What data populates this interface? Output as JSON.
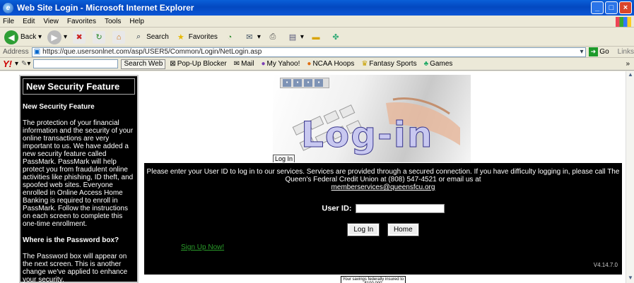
{
  "window": {
    "title": "Web Site Login - Microsoft Internet Explorer"
  },
  "menu": [
    "File",
    "Edit",
    "View",
    "Favorites",
    "Tools",
    "Help"
  ],
  "toolbar": {
    "back": "Back",
    "search": "Search",
    "favorites": "Favorites"
  },
  "address": {
    "label": "Address",
    "url": "https://que.usersonlnet.com/asp/USER5/Common/Login/NetLogin.asp",
    "go": "Go",
    "links": "Links"
  },
  "yahoo": {
    "logo": "Y!",
    "search_web": "Search Web",
    "popup": "Pop-Up Blocker",
    "mail": "Mail",
    "my_yahoo": "My Yahoo!",
    "ncaa": "NCAA Hoops",
    "fantasy": "Fantasy Sports",
    "games": "Games",
    "more": "»"
  },
  "sidebar": {
    "title": "New Security Feature",
    "heading1": "New Security Feature",
    "para1": "The protection of your financial information and the security of your online transactions are very important to us. We have added a new security feature called PassMark. PassMark will help protect you from fraudulent online activities like phishing, ID theft, and spoofed web sites. Everyone enrolled in Online Access Home Banking is required to enroll in PassMark. Follow the instructions on each screen to complete this one-time enrollment.",
    "heading2": "Where is the Password box?",
    "para2": "The Password box will appear on the next screen. This is another change we've applied to enhance your security."
  },
  "hero": {
    "title": "Log-in",
    "tooltip": "Log In"
  },
  "login": {
    "instructions": "Please enter your User ID to log in to our services. Services are provided through a secured connection. If you have difficulty logging in, please call The Queen's Federal Credit Union at (808) 547-4521 or email us at",
    "email": "memberservices@queensfcu.org",
    "userid_label": "User ID:",
    "userid_value": "",
    "login_button": "Log In",
    "home_button": "Home",
    "signup": "Sign Up Now!",
    "version": "V4.14.7.0"
  },
  "footer": {
    "insured": "Your savings federally insured to $100,000"
  }
}
